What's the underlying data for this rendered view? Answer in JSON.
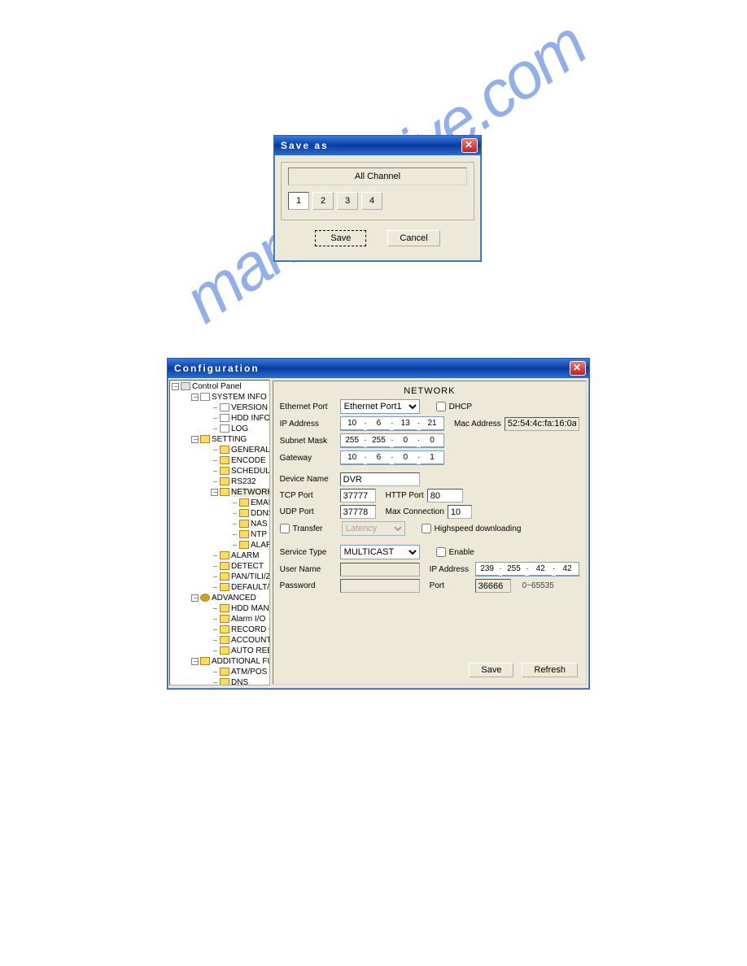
{
  "watermark": "manualshive.com",
  "saveas": {
    "title": "Save as",
    "all_channel": "All Channel",
    "channels": [
      "1",
      "2",
      "3",
      "4"
    ],
    "save": "Save",
    "cancel": "Cancel"
  },
  "config": {
    "title": "Configuration",
    "tree": {
      "root": "Control Panel",
      "groups": [
        {
          "label": "SYSTEM INFO",
          "icon": "page",
          "items": [
            {
              "label": "VERSION",
              "icon": "page"
            },
            {
              "label": "HDD INFO",
              "icon": "page"
            },
            {
              "label": "LOG",
              "icon": "page"
            }
          ]
        },
        {
          "label": "SETTING",
          "icon": "folder",
          "items": [
            {
              "label": "GENERAL",
              "icon": "folder"
            },
            {
              "label": "ENCODE",
              "icon": "folder"
            },
            {
              "label": "SCHEDULE",
              "icon": "folder"
            },
            {
              "label": "RS232",
              "icon": "folder"
            },
            {
              "label": "NETWORK",
              "icon": "folder",
              "selected": true,
              "items": [
                {
                  "label": "EMAIL",
                  "icon": "folder"
                },
                {
                  "label": "DDNS",
                  "icon": "folder"
                },
                {
                  "label": "NAS",
                  "icon": "folder"
                },
                {
                  "label": "NTP",
                  "icon": "folder"
                },
                {
                  "label": "ALARM CENTER",
                  "icon": "folder"
                }
              ]
            },
            {
              "label": "ALARM",
              "icon": "folder"
            },
            {
              "label": "DETECT",
              "icon": "folder"
            },
            {
              "label": "PAN/TILI/ZOOM",
              "icon": "folder"
            },
            {
              "label": "DEFAULT/BACKUP",
              "icon": "folder"
            }
          ]
        },
        {
          "label": "ADVANCED",
          "icon": "gear",
          "items": [
            {
              "label": "HDD MANAGEMENT",
              "icon": "folder"
            },
            {
              "label": "Alarm I/O",
              "icon": "folder"
            },
            {
              "label": "RECORD CONTROL",
              "icon": "folder"
            },
            {
              "label": "ACCOUNT",
              "icon": "folder"
            },
            {
              "label": "AUTO REBOOT",
              "icon": "folder"
            }
          ]
        },
        {
          "label": "ADDITIONAL FUNCTION",
          "icon": "folder",
          "items": [
            {
              "label": "ATM/POS",
              "icon": "folder"
            },
            {
              "label": "DNS",
              "icon": "folder"
            }
          ]
        }
      ]
    },
    "panel": {
      "heading": "NETWORK",
      "ethernet_port_label": "Ethernet Port",
      "ethernet_port_value": "Ethernet Port1",
      "dhcp_label": "DHCP",
      "ip_label": "IP Address",
      "ip": [
        "10",
        "6",
        "13",
        "21"
      ],
      "mac_label": "Mac Address",
      "mac_value": "52:54:4c:fa:16:0a",
      "subnet_label": "Subnet Mask",
      "subnet": [
        "255",
        "255",
        "0",
        "0"
      ],
      "gateway_label": "Gateway",
      "gateway": [
        "10",
        "6",
        "0",
        "1"
      ],
      "device_name_label": "Device Name",
      "device_name_value": "DVR",
      "tcp_port_label": "TCP Port",
      "tcp_port_value": "37777",
      "http_port_label": "HTTP Port",
      "http_port_value": "80",
      "udp_port_label": "UDP Port",
      "udp_port_value": "37778",
      "max_conn_label": "Max Connection",
      "max_conn_value": "10",
      "transfer_label": "Transfer",
      "transfer_value": "Latency",
      "hispeed_label": "Highspeed downloading",
      "service_type_label": "Service Type",
      "service_type_value": "MULTICAST",
      "enable_label": "Enable",
      "user_name_label": "User Name",
      "user_name_value": "",
      "ip2_label": "IP Address",
      "ip2": [
        "239",
        "255",
        "42",
        "42"
      ],
      "password_label": "Password",
      "port_label": "Port",
      "port_value": "36666",
      "port_range": "0~65535",
      "save": "Save",
      "refresh": "Refresh"
    }
  }
}
